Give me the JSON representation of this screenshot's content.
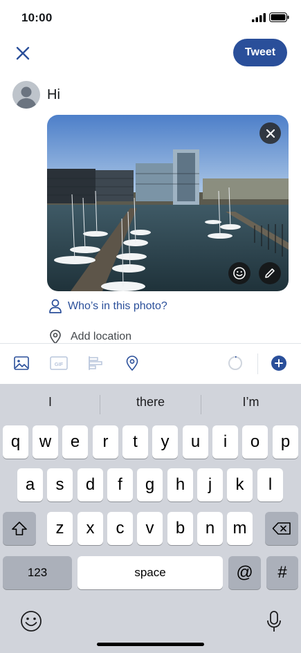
{
  "status_bar": {
    "time": "10:00"
  },
  "header": {
    "tweet_label": "Tweet"
  },
  "composer": {
    "text": "Hi",
    "tag_people_label": "Who’s in this photo?",
    "add_location_label": "Add location"
  },
  "keyboard": {
    "suggestions": [
      "I",
      "there",
      "I’m"
    ],
    "row1": [
      "q",
      "w",
      "e",
      "r",
      "t",
      "y",
      "u",
      "i",
      "o",
      "p"
    ],
    "row2": [
      "a",
      "s",
      "d",
      "f",
      "g",
      "h",
      "j",
      "k",
      "l"
    ],
    "row3": [
      "z",
      "x",
      "c",
      "v",
      "b",
      "n",
      "m"
    ],
    "numbers_label": "123",
    "space_label": "space",
    "at_label": "@",
    "hash_label": "#"
  },
  "colors": {
    "accent": "#2a4f9a",
    "keyboard_bg": "#d1d4db"
  }
}
